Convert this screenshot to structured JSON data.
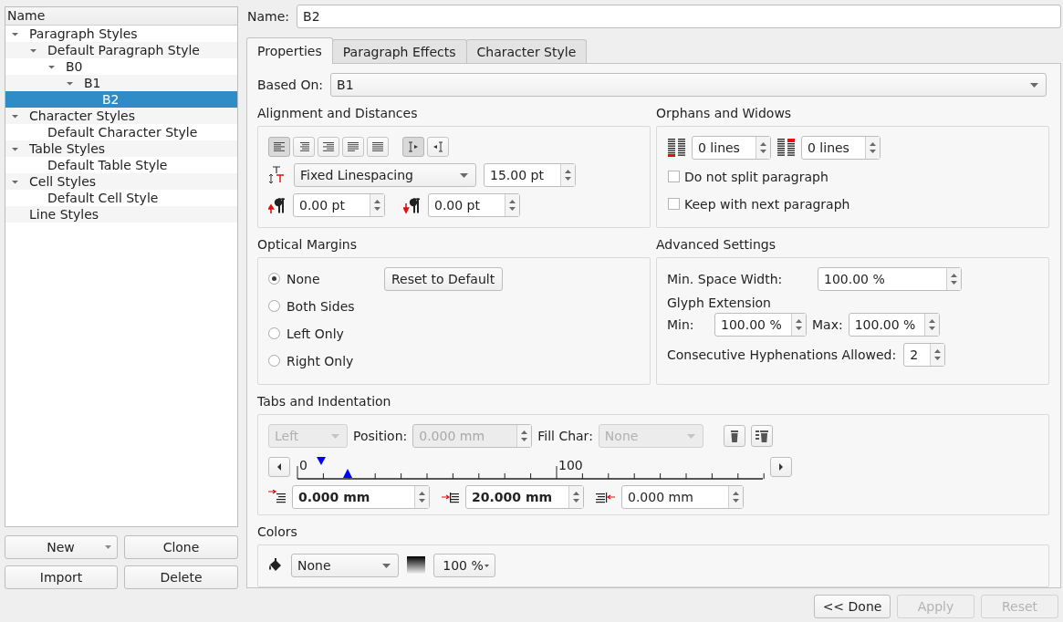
{
  "tree": {
    "header": "Name",
    "items": [
      {
        "label": "Paragraph Styles",
        "expanded": true,
        "selected": false,
        "children": [
          {
            "label": "Default Paragraph Style",
            "expanded": true,
            "selected": false,
            "children": [
              {
                "label": "B0",
                "expanded": true,
                "selected": false,
                "children": [
                  {
                    "label": "B1",
                    "expanded": true,
                    "selected": false,
                    "children": [
                      {
                        "label": "B2",
                        "selected": true
                      }
                    ]
                  }
                ]
              }
            ]
          }
        ]
      },
      {
        "label": "Character Styles",
        "expanded": true,
        "selected": false,
        "children": [
          {
            "label": "Default Character Style",
            "selected": false
          }
        ]
      },
      {
        "label": "Table Styles",
        "expanded": true,
        "selected": false,
        "children": [
          {
            "label": "Default Table Style",
            "selected": false
          }
        ]
      },
      {
        "label": "Cell Styles",
        "expanded": true,
        "selected": false,
        "children": [
          {
            "label": "Default Cell Style",
            "selected": false
          }
        ]
      },
      {
        "label": "Line Styles",
        "selected": false
      }
    ]
  },
  "style_buttons": [
    {
      "label": "New",
      "kind": "menu"
    },
    {
      "label": "Clone",
      "kind": "plain"
    },
    {
      "label": "Import",
      "kind": "plain"
    },
    {
      "label": "Delete",
      "kind": "plain"
    }
  ],
  "name_field": {
    "label": "Name:",
    "value": "B2"
  },
  "tabs": [
    {
      "label": "Properties",
      "selected": true
    },
    {
      "label": "Paragraph Effects",
      "selected": false
    },
    {
      "label": "Character Style",
      "selected": false
    }
  ],
  "based_on": {
    "label": "Based On:",
    "value": "B1"
  },
  "alignment": {
    "title": "Alignment and Distances",
    "align_buttons": [
      {
        "kind": "left",
        "selected": true
      },
      {
        "kind": "center",
        "selected": false
      },
      {
        "kind": "right",
        "selected": false
      },
      {
        "kind": "justify",
        "selected": false
      },
      {
        "kind": "forced",
        "selected": false
      }
    ],
    "direction_buttons": [
      {
        "kind": "ltr",
        "selected": true
      },
      {
        "kind": "rtl",
        "selected": false
      }
    ],
    "line_spacing_mode": "Fixed Linespacing",
    "line_spacing": "15.00 pt",
    "space_above": "0.00 pt",
    "space_below": "0.00 pt"
  },
  "orphans": {
    "title": "Orphans and Widows",
    "orphan_lines": "0 lines",
    "widow_lines": "0 lines",
    "options": [
      {
        "label": "Do not split paragraph",
        "checked": false
      },
      {
        "label": "Keep with next paragraph",
        "checked": false
      }
    ]
  },
  "optical": {
    "title": "Optical Margins",
    "options": [
      {
        "label": "None",
        "selected": true
      },
      {
        "label": "Both Sides",
        "selected": false
      },
      {
        "label": "Left Only",
        "selected": false
      },
      {
        "label": "Right Only",
        "selected": false
      }
    ],
    "reset_button": "Reset to Default"
  },
  "advanced": {
    "title": "Advanced Settings",
    "min_space_label": "Min. Space Width:",
    "min_space": "100.00 %",
    "glyph_title": "Glyph Extension",
    "min_label": "Min:",
    "min": "100.00 %",
    "max_label": "Max:",
    "max": "100.00 %",
    "hyphen_label": "Consecutive Hyphenations Allowed:",
    "hyphen": "2"
  },
  "tabs_indent": {
    "title": "Tabs and Indentation",
    "tab_type": {
      "value": "Left",
      "disabled": true
    },
    "position_label": "Position:",
    "position": {
      "value": "0.000 mm",
      "disabled": true
    },
    "fill_label": "Fill Char:",
    "fill_char": {
      "value": "None",
      "disabled": true
    },
    "ruler_labels": [
      "0",
      "100"
    ],
    "indents": [
      {
        "kind": "first",
        "value": "0.000 mm",
        "modified": true
      },
      {
        "kind": "left",
        "value": "20.000 mm",
        "modified": true
      },
      {
        "kind": "right",
        "value": "0.000 mm",
        "modified": false
      }
    ]
  },
  "colors": {
    "title": "Colors",
    "fill": "None",
    "shade": "100 %"
  },
  "dialog_buttons": [
    {
      "label": "<< Done",
      "disabled": false
    },
    {
      "label": "Apply",
      "disabled": true
    },
    {
      "label": "Reset",
      "disabled": true
    }
  ]
}
